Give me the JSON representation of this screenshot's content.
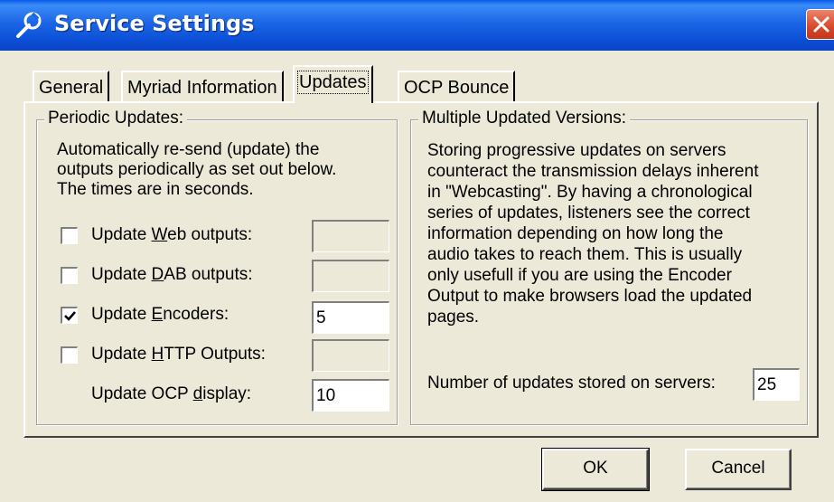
{
  "window": {
    "title": "Service Settings"
  },
  "tabs": [
    {
      "label": "General",
      "active": false
    },
    {
      "label": "Myriad Information",
      "active": false
    },
    {
      "label": "Updates",
      "active": true
    },
    {
      "label": "OCP Bounce",
      "active": false
    }
  ],
  "periodic": {
    "legend": "Periodic Updates:",
    "description": [
      "Automatically re-send (update) the",
      "outputs periodically as set out below.",
      "The times are in seconds."
    ],
    "rows": [
      {
        "label_pre": "Update ",
        "label_key": "W",
        "label_post": "eb outputs:",
        "checked": false,
        "value": ""
      },
      {
        "label_pre": "Update ",
        "label_key": "D",
        "label_post": "AB outputs:",
        "checked": false,
        "value": ""
      },
      {
        "label_pre": "Update ",
        "label_key": "E",
        "label_post": "ncoders:",
        "checked": true,
        "value": "5"
      },
      {
        "label_pre": "Update ",
        "label_key": "H",
        "label_post": "TTP Outputs:",
        "checked": false,
        "value": ""
      }
    ],
    "ocp": {
      "label_pre": "Update OCP ",
      "label_key": "d",
      "label_post": "isplay:",
      "value": "10"
    }
  },
  "versions": {
    "legend": "Multiple Updated Versions:",
    "description": [
      "Storing progressive updates on servers",
      "counteract the transmission delays inherent",
      "in \"Webcasting\". By having a chronological",
      "series of updates, listeners see the correct",
      "information depending on how long the",
      "audio takes to reach them. This is usually",
      "only usefull if you are using the Encoder",
      "Output to make browsers load the updated",
      "pages."
    ],
    "count_label": "Number of updates stored on servers:",
    "count_value": "25"
  },
  "buttons": {
    "ok": "OK",
    "cancel": "Cancel"
  },
  "colors": {
    "titlebar": "#0a58ea",
    "close": "#d8472a",
    "face": "#ece9d8"
  },
  "icons": {
    "title": "wrench-icon",
    "close": "close-icon",
    "check": "checkmark-icon"
  }
}
